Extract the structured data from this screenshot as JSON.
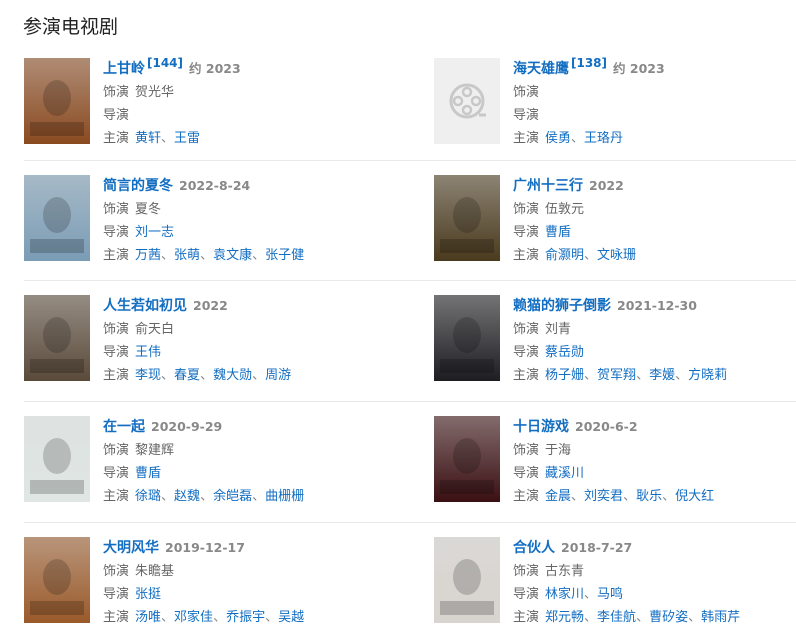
{
  "section_title": "参演电视剧",
  "labels": {
    "role": "饰演",
    "director": "导演",
    "starring": "主演"
  },
  "cards": [
    {
      "title": "上甘岭",
      "badge": "[144]",
      "meta": "约 2023",
      "role": "贺光华",
      "director": [],
      "stars": [
        "黄轩",
        "王雷"
      ],
      "poster": "war-mountain-poster-image",
      "tone": "#8a4a20"
    },
    {
      "title": "海天雄鹰",
      "badge": "[138]",
      "meta": "约 2023",
      "role": "",
      "director": [],
      "stars": [
        "侯勇",
        "王珞丹"
      ],
      "poster": "film-reel-placeholder-icon",
      "tone": "#efefef"
    },
    {
      "title": "简言的夏冬",
      "badge": "",
      "meta": "2022-8-24",
      "role": "夏冬",
      "director": [
        "刘一志"
      ],
      "stars": [
        "万茜",
        "张萌",
        "袁文康",
        "张子健"
      ],
      "poster": "group-portrait-poster-image",
      "tone": "#7a9cb5"
    },
    {
      "title": "广州十三行",
      "badge": "",
      "meta": "2022",
      "role": "伍敦元",
      "director": [
        "曹盾"
      ],
      "stars": [
        "俞灏明",
        "文咏珊"
      ],
      "poster": "calligraphy-gold-poster-image",
      "tone": "#4a3a1e"
    },
    {
      "title": "人生若如初见",
      "badge": "",
      "meta": "2022",
      "role": "俞天白",
      "director": [
        "王伟"
      ],
      "stars": [
        "李现",
        "春夏",
        "魏大勋",
        "周游"
      ],
      "poster": "period-group-poster-image",
      "tone": "#5a4a3a"
    },
    {
      "title": "赖猫的狮子倒影",
      "badge": "",
      "meta": "2021-12-30",
      "role": "刘青",
      "director": [
        "蔡岳勋"
      ],
      "stars": [
        "杨子姗",
        "贺军翔",
        "李媛",
        "方晓莉"
      ],
      "poster": "couple-dark-poster-image",
      "tone": "#1e1e22"
    },
    {
      "title": "在一起",
      "badge": "",
      "meta": "2020-9-29",
      "role": "黎建辉",
      "director": [
        "曹盾"
      ],
      "stars": [
        "徐璐",
        "赵魏",
        "余皑磊",
        "曲栅栅"
      ],
      "poster": "calligraphy-white-poster-image",
      "tone": "#dfe6e4"
    },
    {
      "title": "十日游戏",
      "badge": "",
      "meta": "2020-6-2",
      "role": "于海",
      "director": [
        "藏溪川"
      ],
      "stars": [
        "金晨",
        "刘奕君",
        "耿乐",
        "倪大红"
      ],
      "poster": "red-title-poster-image",
      "tone": "#3a0f12"
    },
    {
      "title": "大明风华",
      "badge": "",
      "meta": "2019-12-17",
      "role": "朱瞻基",
      "director": [
        "张挺"
      ],
      "stars": [
        "汤唯",
        "邓家佳",
        "乔振宇",
        "吴越"
      ],
      "poster": "imperial-costume-poster-image",
      "tone": "#9a5a2a"
    },
    {
      "title": "合伙人",
      "badge": "",
      "meta": "2018-7-27",
      "role": "古东青",
      "director": [
        "林家川",
        "马鸣"
      ],
      "stars": [
        "郑元畅",
        "李佳航",
        "曹矽姿",
        "韩雨芹"
      ],
      "poster": "business-suits-poster-image",
      "tone": "#d8d4cf"
    }
  ]
}
